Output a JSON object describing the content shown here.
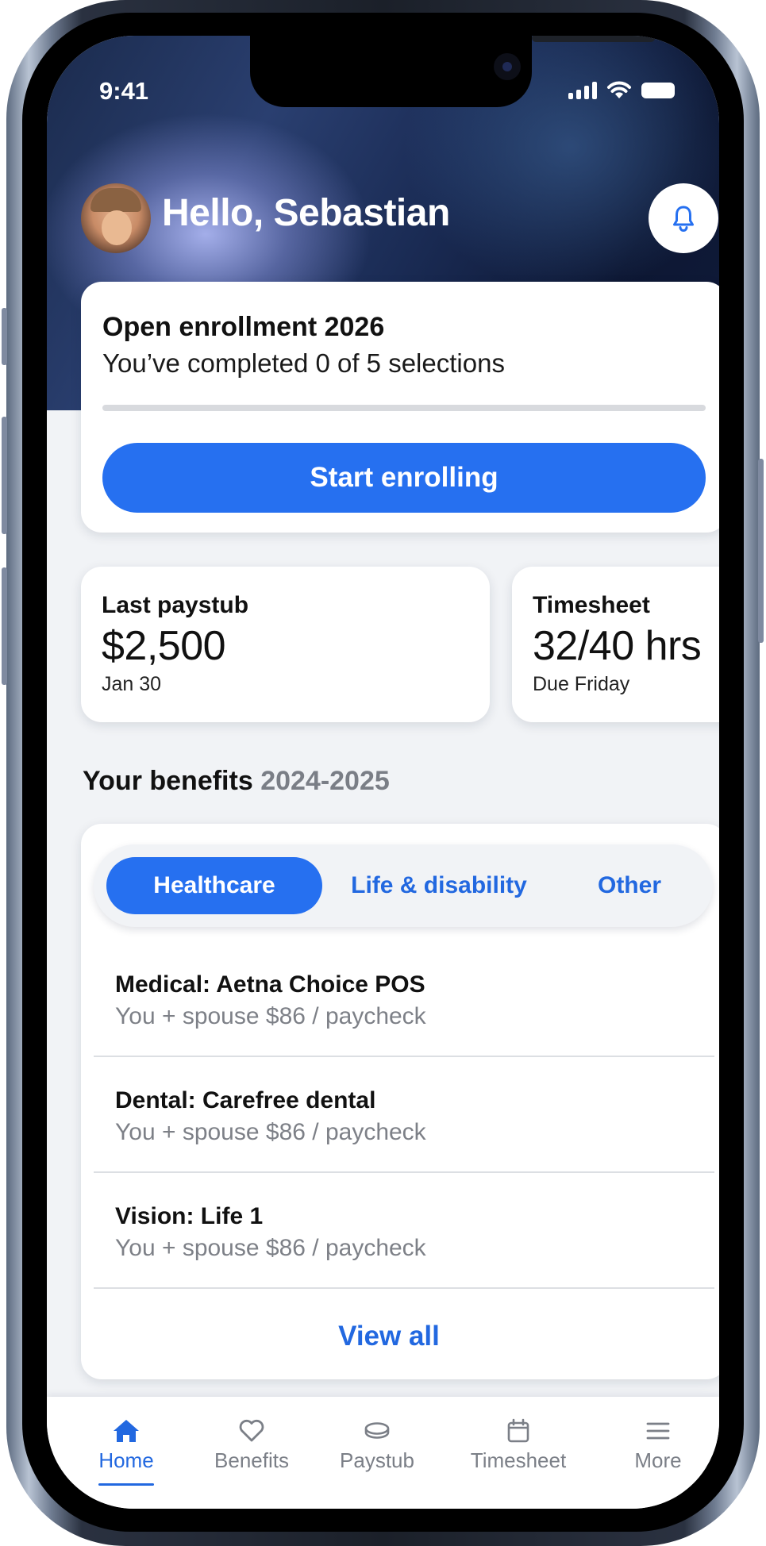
{
  "status_bar": {
    "time": "9:41"
  },
  "header": {
    "greeting": "Hello, Sebastian"
  },
  "enrollment": {
    "title": "Open enrollment 2026",
    "subtitle": "You’ve completed 0 of 5 selections",
    "completed": 0,
    "total": 5,
    "button_label": "Start enrolling"
  },
  "summary_cards": [
    {
      "label": "Last paystub",
      "value": "$2,500",
      "sub": "Jan 30"
    },
    {
      "label": "Timesheet",
      "value": "32/40 hrs",
      "sub": "Due Friday"
    }
  ],
  "benefits": {
    "title": "Your benefits",
    "year": "2024-2025",
    "tabs": [
      "Healthcare",
      "Life & disability",
      "Other"
    ],
    "active_tab": "Healthcare",
    "items": [
      {
        "title": "Medical: Aetna Choice POS",
        "desc": "You + spouse $86 / paycheck"
      },
      {
        "title": "Dental: Carefree dental",
        "desc": "You + spouse $86 / paycheck"
      },
      {
        "title": "Vision: Life 1",
        "desc": "You + spouse $86 / paycheck"
      }
    ],
    "view_all_label": "View all"
  },
  "tab_bar": {
    "items": [
      {
        "label": "Home",
        "icon": "home-icon"
      },
      {
        "label": "Benefits",
        "icon": "heart-icon"
      },
      {
        "label": "Paystub",
        "icon": "coins-icon"
      },
      {
        "label": "Timesheet",
        "icon": "calendar-icon"
      },
      {
        "label": "More",
        "icon": "menu-icon"
      }
    ],
    "active": "Home"
  },
  "colors": {
    "accent": "#2670f0",
    "link": "#2268e0",
    "muted_text": "#7d8087",
    "background": "#f1f3f6"
  }
}
